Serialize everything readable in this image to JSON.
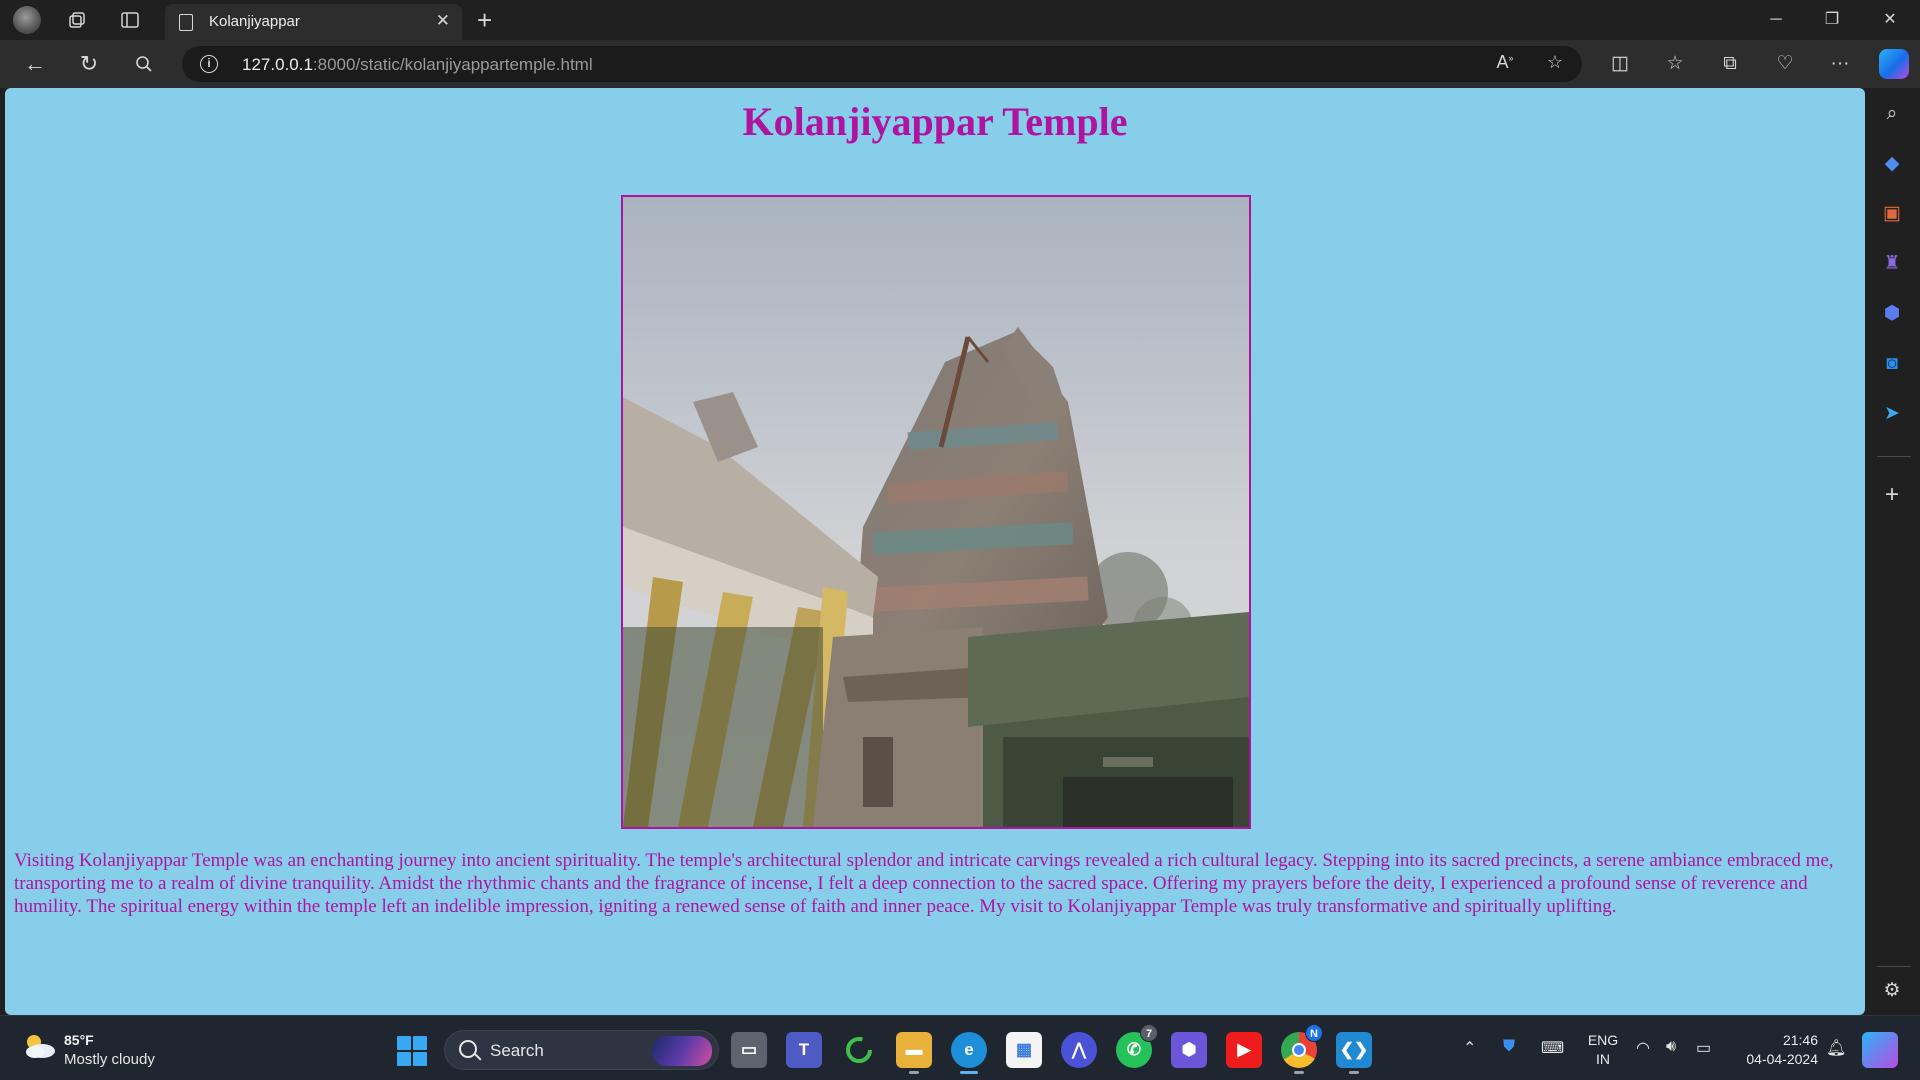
{
  "browser": {
    "tab_title": "Kolanjiyappar",
    "url_host": "127.0.0.1",
    "url_rest": ":8000/static/kolanjiyappartemple.html"
  },
  "page": {
    "title": "Kolanjiyappar Temple",
    "image_alt": "Kolanjiyappar Temple gopuram",
    "description": "Visiting Kolanjiyappar Temple was an enchanting journey into ancient spirituality. The temple's architectural splendor and intricate carvings revealed a rich cultural legacy. Stepping into its sacred precincts, a serene ambiance embraced me, transporting me to a realm of divine tranquility. Amidst the rhythmic chants and the fragrance of incense, I felt a deep connection to the sacred space. Offering my prayers before the deity, I experienced a profound sense of reverence and humility. The spiritual energy within the temple left an indelible impression, igniting a renewed sense of faith and inner peace. My visit to Kolanjiyappar Temple was truly transformative and spiritually uplifting."
  },
  "taskbar": {
    "weather_temp": "85°F",
    "weather_desc": "Mostly cloudy",
    "search_label": "Search",
    "whatsapp_badge": "7",
    "chrome_badge": "N",
    "lang_line1": "ENG",
    "lang_line2": "IN",
    "time": "21:46",
    "date": "04-04-2024"
  },
  "colors": {
    "page_background": "#87ceeb",
    "heading_text": "#b0139e",
    "browser_chrome": "#202020"
  }
}
